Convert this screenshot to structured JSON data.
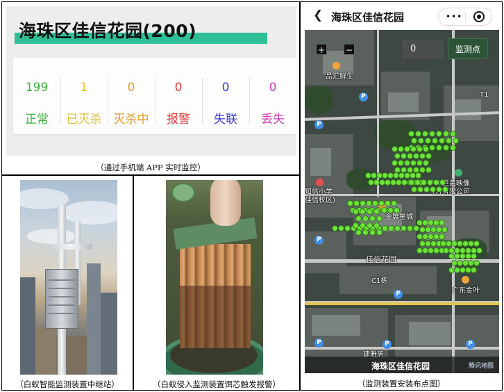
{
  "panel_a": {
    "title": "海珠区佳信花园(200)",
    "accent_color": "#2fbf96",
    "stats": [
      {
        "value": "199",
        "label": "正常",
        "color": "#3cb33c"
      },
      {
        "value": "1",
        "label": "已灭杀",
        "color": "#d9c23a"
      },
      {
        "value": "0",
        "label": "灭杀中",
        "color": "#e59a2a"
      },
      {
        "value": "0",
        "label": "报警",
        "color": "#e23a3a"
      },
      {
        "value": "0",
        "label": "失联",
        "color": "#3a3fd0"
      },
      {
        "value": "0",
        "label": "丢失",
        "color": "#cf3fb7"
      }
    ],
    "caption": "（通过手机端 APP 实时监控）"
  },
  "panel_b": {
    "caption": "（白蚁智能监测装置中继站）"
  },
  "panel_c": {
    "caption": "（白蚁侵入监测装置饵芯触发报警）"
  },
  "panel_d": {
    "nav_title": "海珠区佳信花园",
    "back_icon": "chevron-left-icon",
    "more_icon": "more-dots-icon",
    "record_icon": "record-icon",
    "zoom_in": "+",
    "zoom_out": "−",
    "count_value": "0",
    "monitor_button": "监测点",
    "labels": {
      "shop": "品汇鲜生",
      "school_1": "知信小学",
      "school_2": "佳信校区)",
      "cinema_1": "广州巨盖映像",
      "cinema_2": "(万有限公司",
      "mall": "金展星城",
      "garden": "佳信花园",
      "building": "C1栋",
      "bank": "广东金叶",
      "residence": "建雅居",
      "tag": "T1"
    },
    "footer_title": "海珠区佳信花园",
    "footer_logo": "腾讯地图",
    "caption": "（监测装置安装布点图）"
  }
}
